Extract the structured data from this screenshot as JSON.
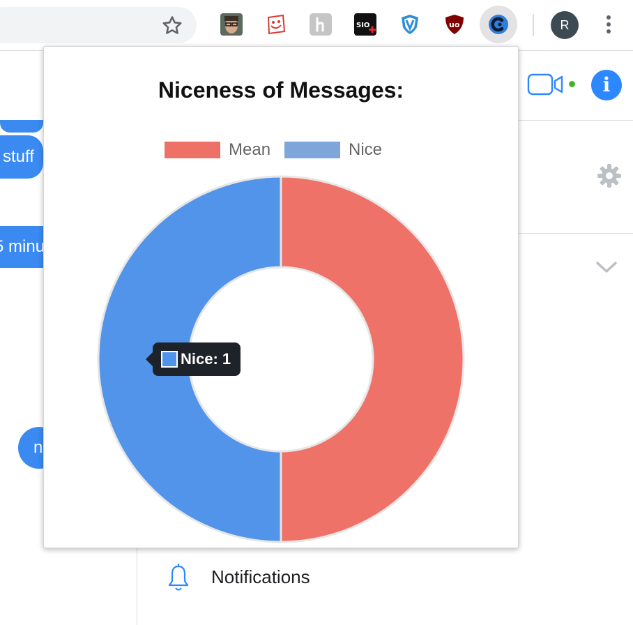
{
  "browser": {
    "profile_initial": "R",
    "extensions": [
      {
        "icon": "face-photo-icon"
      },
      {
        "icon": "grinning-card-icon"
      },
      {
        "icon": "honey-h-icon"
      },
      {
        "icon": "sio-plus-icon"
      },
      {
        "icon": "shield-v-icon"
      },
      {
        "icon": "ublock-origin-icon"
      },
      {
        "icon": "c-logo-extension-icon",
        "active": true
      }
    ]
  },
  "background": {
    "bubbles": [
      "stuff",
      "5 minu",
      "n"
    ],
    "notifications_label": "Notifications"
  },
  "popup": {
    "chart_data": {
      "type": "pie",
      "subtype": "doughnut",
      "title": "Niceness of Messages:",
      "categories": [
        "Mean",
        "Nice"
      ],
      "values": [
        1,
        1
      ],
      "colors": [
        "#ef7269",
        "#5194ea"
      ],
      "legend_colors": [
        "#ee7168",
        "#7fa6da"
      ],
      "legend_position": "top"
    },
    "tooltip": {
      "text": "Nice: 1",
      "color": "#4f94ea"
    }
  }
}
